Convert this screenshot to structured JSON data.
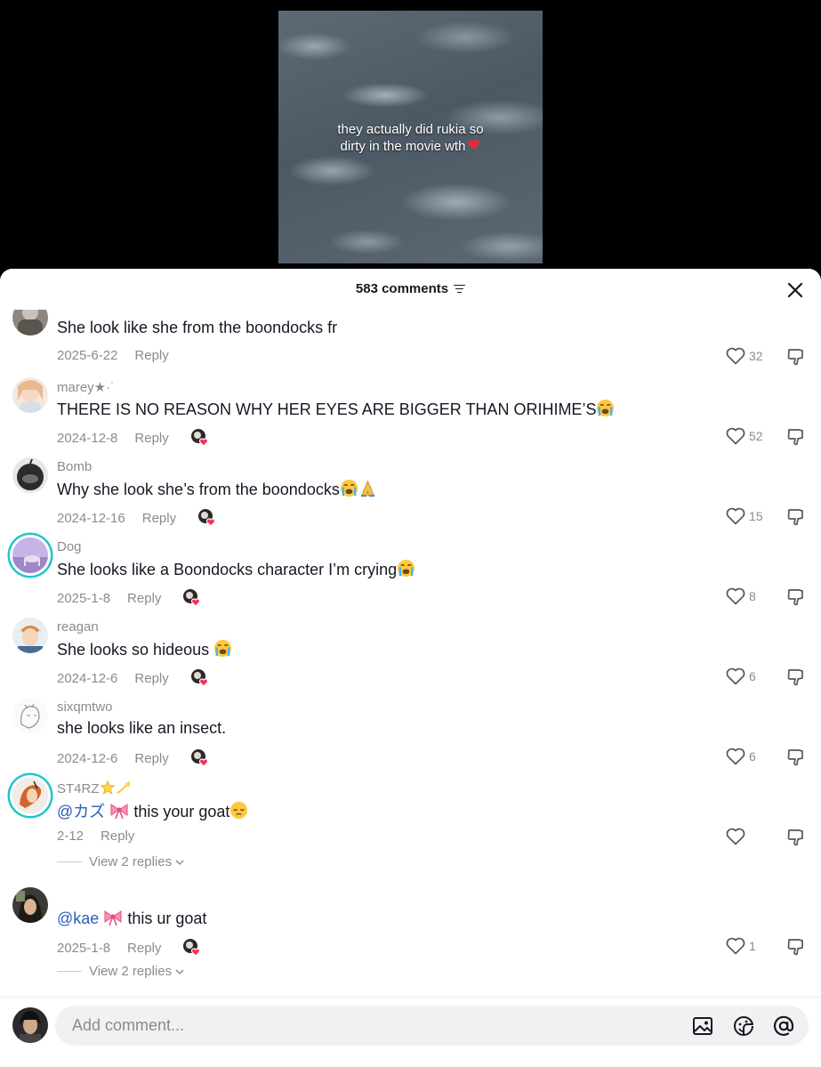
{
  "video": {
    "caption_line1": "they actually did rukia so",
    "caption_line2": "dirty in the movie wth",
    "caption_emoji": "broken-heart"
  },
  "sheet": {
    "title": "583 comments",
    "filter_icon": "filter-icon",
    "close_icon": "close-icon"
  },
  "comments": [
    {
      "username": "",
      "text": "She look like she from the boondocks fr",
      "date": "2025-6-22",
      "reply": "Reply",
      "likes": "32",
      "creator_liked": false
    },
    {
      "username": "marey★·˙",
      "text": "THERE IS NO REASON WHY HER EYES ARE BIGGER THAN ORIHIME’S",
      "date": "2024-12-8",
      "reply": "Reply",
      "likes": "52",
      "creator_liked": true
    },
    {
      "username": "Bomb",
      "text": "Why she look she’s from the boondocks",
      "date": "2024-12-16",
      "reply": "Reply",
      "likes": "15",
      "creator_liked": true
    },
    {
      "username": "Dog",
      "text": "She looks like a Boondocks character I’m crying",
      "date": "2025-1-8",
      "reply": "Reply",
      "likes": "8",
      "creator_liked": true
    },
    {
      "username": "reagan",
      "text": "She looks so hideous ",
      "date": "2024-12-6",
      "reply": "Reply",
      "likes": "6",
      "creator_liked": true
    },
    {
      "username": "sixqmtwo",
      "text": "she looks like an insect.",
      "date": "2024-12-6",
      "reply": "Reply",
      "likes": "6",
      "creator_liked": true
    },
    {
      "username": "ST4RZ",
      "mention": "@カズ",
      "text": "this your goat",
      "date": "2-12",
      "reply": "Reply",
      "likes": "",
      "creator_liked": false,
      "view_replies": "View 2 replies"
    },
    {
      "username": "",
      "mention": "@kae",
      "text": "this ur goat",
      "date": "2025-1-8",
      "reply": "Reply",
      "likes": "1",
      "creator_liked": true,
      "view_replies": "View 2 replies"
    }
  ],
  "bottom_bar": {
    "placeholder": "Add comment...",
    "icons": [
      "image-icon",
      "sticker-icon",
      "mention-icon"
    ]
  },
  "colors": {
    "accent_ring": "#20c5c9",
    "mention": "#2b5db9",
    "secondary_text": "#8a8b91",
    "primary_text": "#161823"
  }
}
